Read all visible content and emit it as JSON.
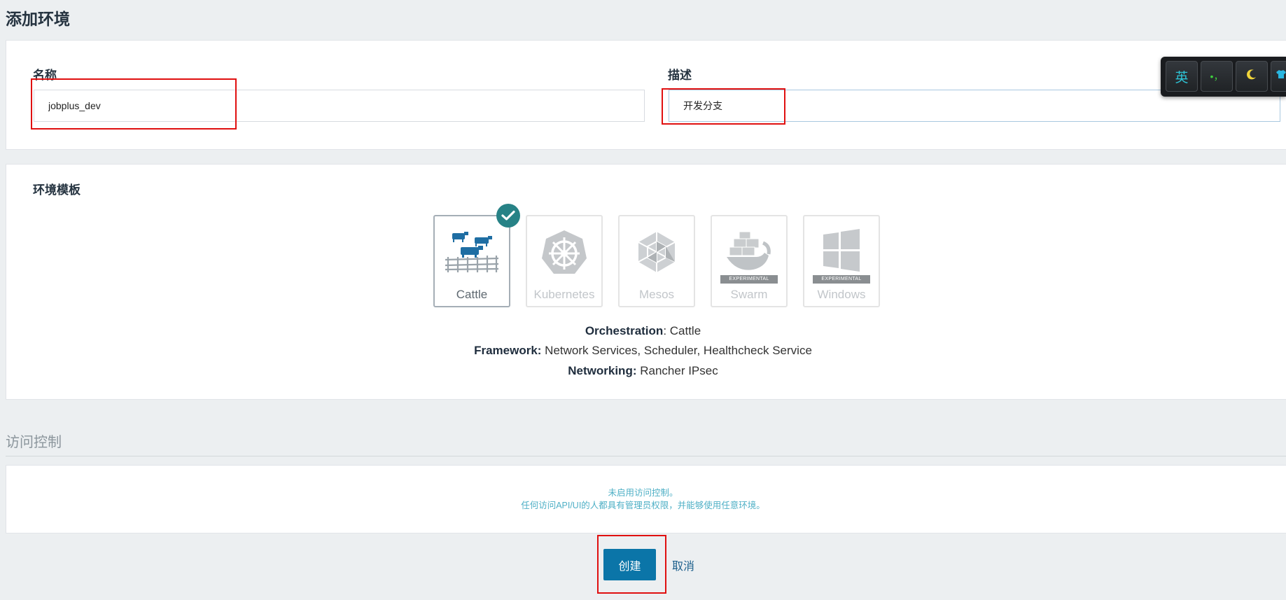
{
  "page": {
    "title": "添加环境"
  },
  "form": {
    "name_label": "名称",
    "name_value": "jobplus_dev",
    "description_label": "描述",
    "description_value": "开发分支"
  },
  "template": {
    "title": "环境模板",
    "options": [
      {
        "label": "Cattle",
        "selected": true,
        "experimental": false,
        "icon": "cattle-icon"
      },
      {
        "label": "Kubernetes",
        "selected": false,
        "experimental": false,
        "icon": "kubernetes-icon"
      },
      {
        "label": "Mesos",
        "selected": false,
        "experimental": false,
        "icon": "mesos-icon"
      },
      {
        "label": "Swarm",
        "selected": false,
        "experimental": true,
        "badge": "EXPERIMENTAL",
        "icon": "swarm-icon"
      },
      {
        "label": "Windows",
        "selected": false,
        "experimental": true,
        "badge": "EXPERIMENTAL",
        "icon": "windows-icon"
      }
    ],
    "details": {
      "orchestration_label": "Orchestration",
      "orchestration_value": ": Cattle",
      "framework_label": "Framework:",
      "framework_value": " Network Services, Scheduler, Healthcheck Service",
      "networking_label": "Networking:",
      "networking_value": " Rancher IPsec"
    }
  },
  "access": {
    "title": "访问控制",
    "line1": "未启用访问控制。",
    "line2": "任何访问API/UI的人都具有管理员权限，并能够使用任意环境。"
  },
  "actions": {
    "create_label": "创建",
    "cancel_label": "取消"
  },
  "ime": {
    "lang_label": "英",
    "punct_label": "•，"
  },
  "colors": {
    "primary": "#0b75a8",
    "selected_check": "#278286",
    "info_text": "#4fb0c6",
    "annotation": "#e01010"
  }
}
